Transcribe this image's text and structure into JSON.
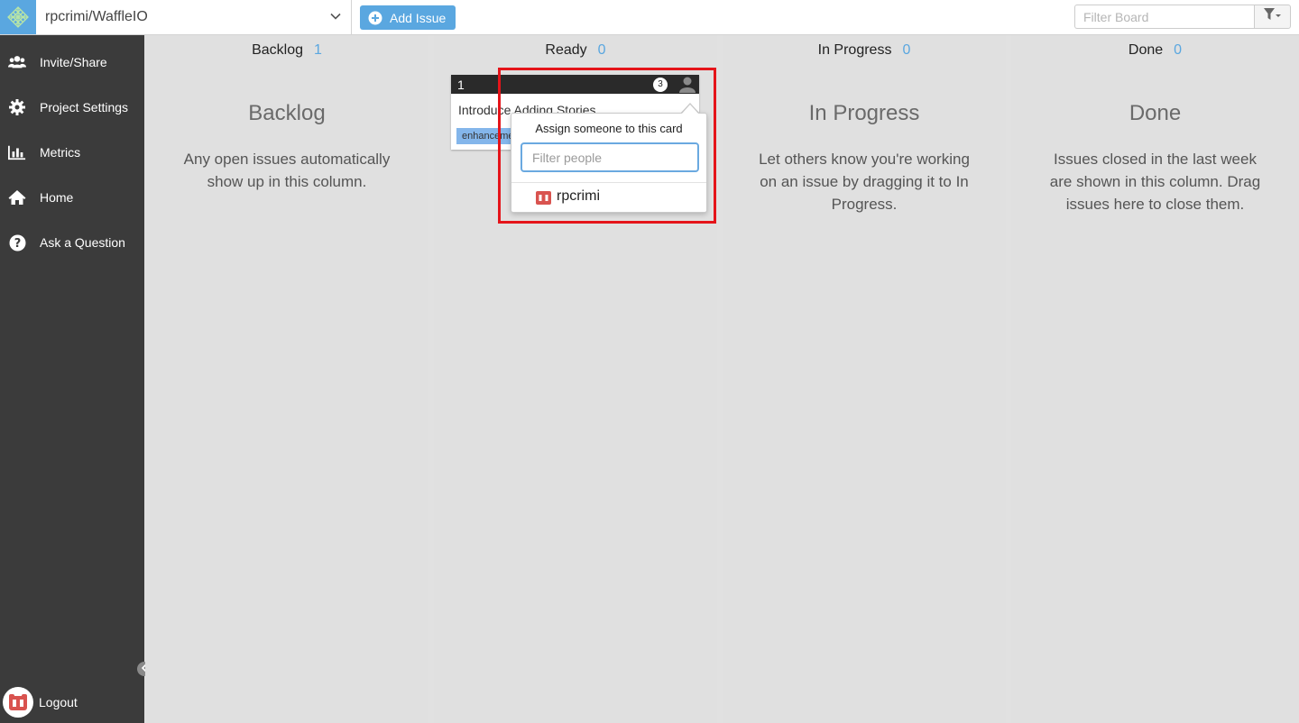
{
  "topbar": {
    "repo_name": "rpcrimi/WaffleIO",
    "add_issue_label": "Add Issue",
    "filter_placeholder": "Filter Board"
  },
  "sidebar": {
    "items": [
      {
        "label": "Invite/Share",
        "icon": "users-icon"
      },
      {
        "label": "Project Settings",
        "icon": "gear-icon"
      },
      {
        "label": "Metrics",
        "icon": "bar-chart-icon"
      },
      {
        "label": "Home",
        "icon": "home-icon"
      },
      {
        "label": "Ask a Question",
        "icon": "question-icon"
      }
    ],
    "logout_label": "Logout"
  },
  "columns": [
    {
      "name": "Backlog",
      "count": "1",
      "title": "Backlog",
      "desc": "Any open issues automatically show up in this column."
    },
    {
      "name": "Ready",
      "count": "0",
      "title": "",
      "desc": ""
    },
    {
      "name": "In Progress",
      "count": "0",
      "title": "In Progress",
      "desc": "Let others know you're working on an issue by dragging it to In Progress."
    },
    {
      "name": "Done",
      "count": "0",
      "title": "Done",
      "desc": "Issues closed in the last week are shown in this column. Drag issues here to close them."
    }
  ],
  "card": {
    "number": "1",
    "badge": "3",
    "title": "Introduce Adding Stories",
    "label": "enhancement"
  },
  "assign_popover": {
    "title": "Assign someone to this card",
    "filter_placeholder": "Filter people",
    "people": [
      {
        "name": "rpcrimi"
      }
    ]
  },
  "colors": {
    "accent": "#5aa7e0",
    "sidebar_bg": "#3b3b3b",
    "column_bg": "#e0e0e0",
    "highlight": "#e5141a",
    "label_enhancement": "#84b6eb"
  }
}
